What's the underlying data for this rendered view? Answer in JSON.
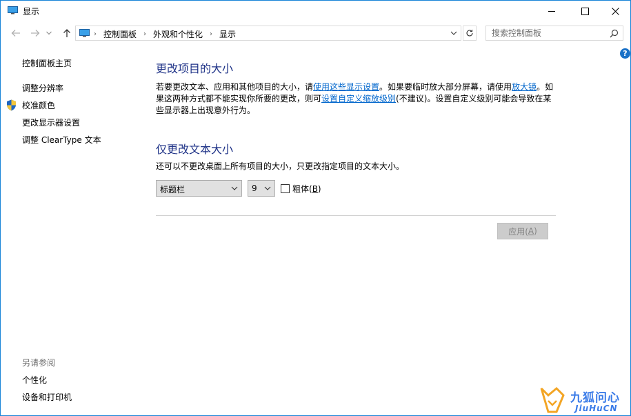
{
  "window": {
    "title": "显示"
  },
  "address": {
    "crumbs": [
      "控制面板",
      "外观和个性化",
      "显示"
    ]
  },
  "search": {
    "placeholder": "搜索控制面板"
  },
  "help": {
    "label": "?"
  },
  "sidebar": {
    "items": [
      {
        "label": "控制面板主页"
      },
      {
        "label": "调整分辨率"
      },
      {
        "label": "校准颜色"
      },
      {
        "label": "更改显示器设置"
      },
      {
        "label": "调整 ClearType 文本"
      }
    ],
    "see_also_title": "另请参阅",
    "see_also": [
      {
        "label": "个性化"
      },
      {
        "label": "设备和打印机"
      }
    ]
  },
  "section1": {
    "title": "更改项目的大小",
    "p_a": "若要更改文本、应用和其他项目的大小，请",
    "link1": "使用这些显示设置",
    "p_b": "。如果要临时放大部分屏幕，请使用",
    "link2": "放大镜",
    "p_c": "。如果这两种方式都不能实现你所要的更改，则可",
    "link3": "设置自定义缩放级别",
    "p_d": "(不建议)。设置自定义级别可能会导致在某些显示器上出现意外行为。"
  },
  "section2": {
    "title": "仅更改文本大小",
    "desc": "还可以不更改桌面上所有项目的大小，只更改指定项目的文本大小。",
    "element_select": "标题栏",
    "size_select": "9",
    "bold_label": "粗体(",
    "bold_mnemonic": "B",
    "bold_end": ")"
  },
  "apply": {
    "label": "应用(",
    "mnemonic": "A",
    "end": ")"
  },
  "watermark": {
    "text": "九狐问心",
    "sub": "JiuHuCN"
  },
  "colors": {
    "title_blue": "#1e3287",
    "link_blue": "#0066cc",
    "window_border": "#1883d7"
  }
}
